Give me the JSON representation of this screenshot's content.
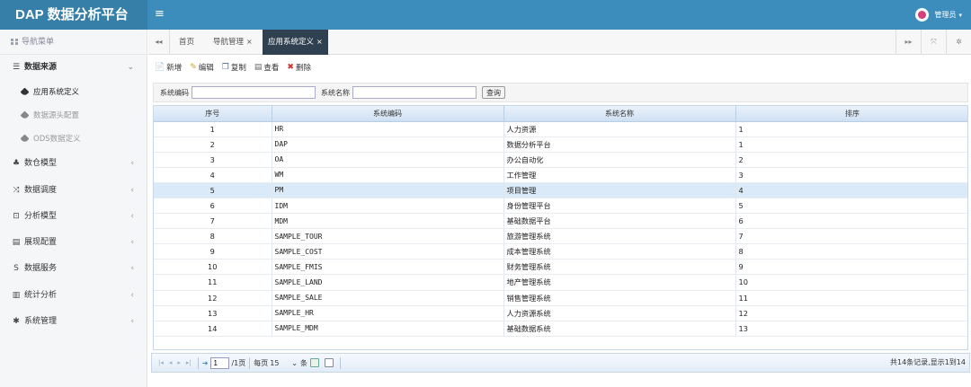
{
  "header": {
    "brand": "DAP 数据分析平台",
    "menu_toggle_glyph": "≡",
    "user_name": "管理员",
    "caret": "▾"
  },
  "sidebar": {
    "title": "导航菜单",
    "menus": [
      {
        "label": "数据来源",
        "icon": "database-icon",
        "glyph": "☰",
        "arrow": "⌄",
        "open": true,
        "children": [
          {
            "label": "应用系统定义",
            "active": true
          },
          {
            "label": "数据源头配置",
            "active": false
          },
          {
            "label": "ODS数据定义",
            "active": false
          }
        ]
      },
      {
        "label": "数仓模型",
        "icon": "cubes-icon",
        "glyph": "♣",
        "arrow": "‹"
      },
      {
        "label": "数据调度",
        "icon": "shuffle-icon",
        "glyph": "⤨",
        "arrow": "‹"
      },
      {
        "label": "分析模型",
        "icon": "model-icon",
        "glyph": "⊡",
        "arrow": "‹"
      },
      {
        "label": "展现配置",
        "icon": "film-icon",
        "glyph": "▤",
        "arrow": "‹"
      },
      {
        "label": "数据服务",
        "icon": "service-icon",
        "glyph": "S",
        "arrow": "‹"
      },
      {
        "label": "统计分析",
        "icon": "bar-chart-icon",
        "glyph": "▥",
        "arrow": "‹"
      },
      {
        "label": "系统管理",
        "icon": "gear-icon",
        "glyph": "✱",
        "arrow": "‹"
      }
    ]
  },
  "tabs": {
    "prev_glyph": "◂◂",
    "next_glyph": "▸▸",
    "items": [
      {
        "label": "首页",
        "closable": false,
        "active": false
      },
      {
        "label": "导航管理",
        "closable": true,
        "active": false
      },
      {
        "label": "应用系统定义",
        "closable": true,
        "active": true
      }
    ],
    "close_glyph": "×",
    "fullscreen_glyph": "⤧",
    "settings_glyph": "✲"
  },
  "toolbar": {
    "buttons": [
      {
        "label": "新增",
        "icon": "add-icon",
        "glyph": "📄",
        "color": "#3a8a3a"
      },
      {
        "label": "编辑",
        "icon": "edit-icon",
        "glyph": "✎",
        "color": "#c8a020"
      },
      {
        "label": "复制",
        "icon": "copy-icon",
        "glyph": "❐",
        "color": "#4470b0"
      },
      {
        "label": "查看",
        "icon": "view-icon",
        "glyph": "▤",
        "color": "#666666"
      },
      {
        "label": "删除",
        "icon": "delete-icon",
        "glyph": "✖",
        "color": "#d03030"
      }
    ]
  },
  "search": {
    "code_label": "系统编码",
    "code_value": "",
    "name_label": "系统名称",
    "name_value": "",
    "query_button": "查询"
  },
  "grid": {
    "columns": [
      "序号",
      "系统编码",
      "系统名称",
      "排序"
    ],
    "selected_row": 4,
    "rows": [
      [
        "1",
        "HR",
        "人力资源",
        "1"
      ],
      [
        "2",
        "DAP",
        "数据分析平台",
        "1"
      ],
      [
        "3",
        "OA",
        "办公自动化",
        "2"
      ],
      [
        "4",
        "WM",
        "工作管理",
        "3"
      ],
      [
        "5",
        "PM",
        "项目管理",
        "4"
      ],
      [
        "6",
        "IDM",
        "身份管理平台",
        "5"
      ],
      [
        "7",
        "MDM",
        "基础数据平台",
        "6"
      ],
      [
        "8",
        "SAMPLE_TOUR",
        "旅游管理系统",
        "7"
      ],
      [
        "9",
        "SAMPLE_COST",
        "成本管理系统",
        "8"
      ],
      [
        "10",
        "SAMPLE_FMIS",
        "财务管理系统",
        "9"
      ],
      [
        "11",
        "SAMPLE_LAND",
        "地产管理系统",
        "10"
      ],
      [
        "12",
        "SAMPLE_SALE",
        "销售管理系统",
        "11"
      ],
      [
        "13",
        "SAMPLE_HR",
        "人力资源系统",
        "12"
      ],
      [
        "14",
        "SAMPLE_MDM",
        "基础数据系统",
        "13"
      ]
    ]
  },
  "pager": {
    "first": "|◂",
    "prev": "◂",
    "next": "▸",
    "last": "▸|",
    "goto": "➜",
    "page_value": "1",
    "total_pages": "/1页",
    "per_page_label": "每页",
    "per_page_value": "15",
    "per_page_arrow": "⌄",
    "per_page_unit": "条",
    "summary": "共14条记录,显示1到14"
  }
}
